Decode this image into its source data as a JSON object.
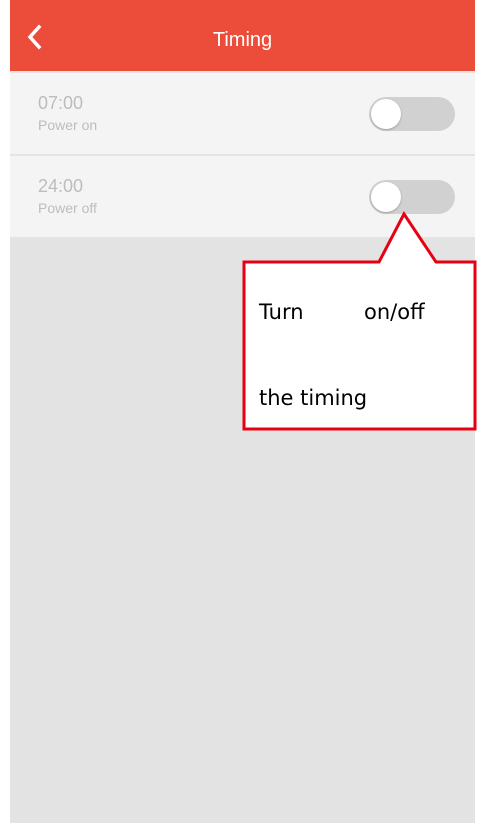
{
  "header": {
    "title": "Timing",
    "back_icon": "chevron-left-icon"
  },
  "timers": [
    {
      "time": "07:00",
      "label": "Power on",
      "enabled": false
    },
    {
      "time": "24:00",
      "label": "Power off",
      "enabled": false
    }
  ],
  "callout": {
    "line1_word1": "Turn",
    "line1_word2": "on/off",
    "line2": "the timing"
  },
  "colors": {
    "header": "#ec4c3a",
    "background": "#e3e3e3",
    "row": "#f4f4f4",
    "toggle_off": "#d1d1d1",
    "callout_border": "#e60012"
  }
}
